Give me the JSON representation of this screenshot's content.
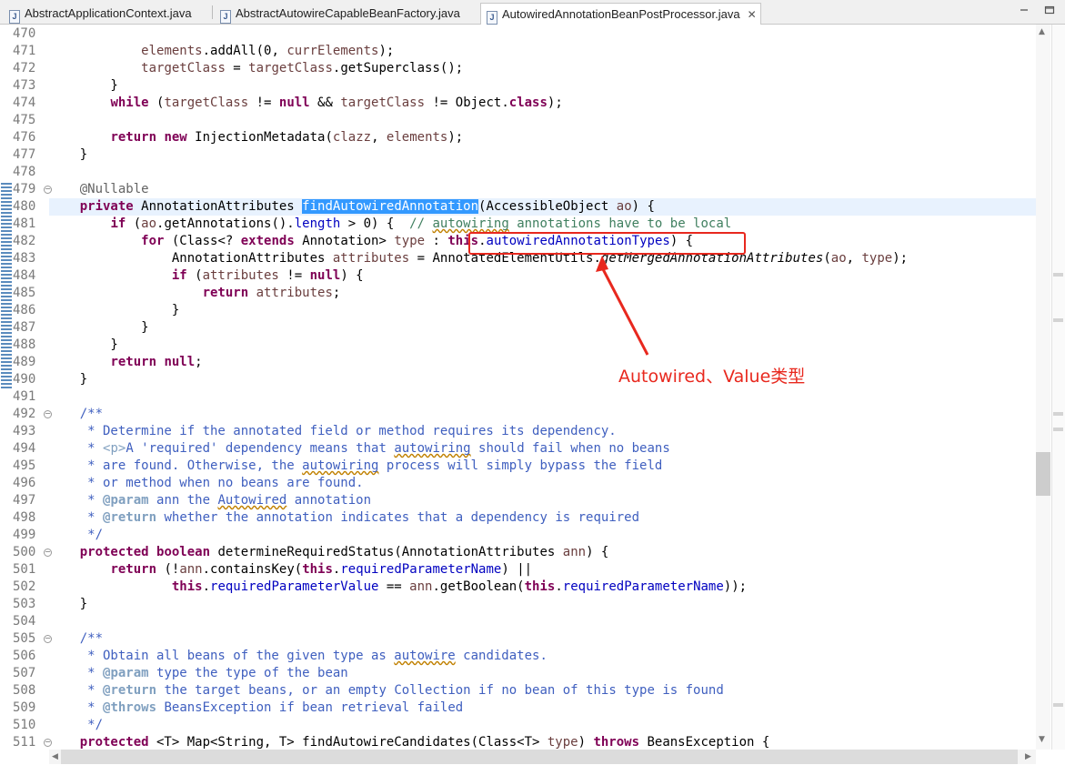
{
  "tabs": [
    {
      "label": "AbstractApplicationContext.java",
      "active": false
    },
    {
      "label": "AbstractAutowireCapableBeanFactory.java",
      "active": false
    },
    {
      "label": "AutowiredAnnotationBeanPostProcessor.java",
      "active": true
    }
  ],
  "tab_close_glyph": "✕",
  "file_icon_glyph": "J",
  "fold_glyph": "⊖",
  "code": {
    "first_line": 470,
    "current_line": 480,
    "fold_lines": [
      479,
      492,
      500,
      505,
      511
    ],
    "lines": [
      "",
      "            elements.addAll(0, currElements);",
      "            targetClass = targetClass.getSuperclass();",
      "        }",
      "        while (targetClass != null && targetClass != Object.class);",
      "",
      "        return new InjectionMetadata(clazz, elements);",
      "    }",
      "",
      "    @Nullable",
      "    private AnnotationAttributes findAutowiredAnnotation(AccessibleObject ao) {",
      "        if (ao.getAnnotations().length > 0) {  // autowiring annotations have to be local",
      "            for (Class<? extends Annotation> type : this.autowiredAnnotationTypes) {",
      "                AnnotationAttributes attributes = AnnotatedElementUtils.getMergedAnnotationAttributes(ao, type);",
      "                if (attributes != null) {",
      "                    return attributes;",
      "                }",
      "            }",
      "        }",
      "        return null;",
      "    }",
      "",
      "    /**",
      "     * Determine if the annotated field or method requires its dependency.",
      "     * <p>A 'required' dependency means that autowiring should fail when no beans",
      "     * are found. Otherwise, the autowiring process will simply bypass the field",
      "     * or method when no beans are found.",
      "     * @param ann the Autowired annotation",
      "     * @return whether the annotation indicates that a dependency is required",
      "     */",
      "    protected boolean determineRequiredStatus(AnnotationAttributes ann) {",
      "        return (!ann.containsKey(this.requiredParameterName) ||",
      "                this.requiredParameterValue == ann.getBoolean(this.requiredParameterName));",
      "    }",
      "",
      "    /**",
      "     * Obtain all beans of the given type as autowire candidates.",
      "     * @param type the type of the bean",
      "     * @return the target beans, or an empty Collection if no bean of this type is found",
      "     * @throws BeansException if bean retrieval failed",
      "     */",
      "    protected <T> Map<String, T> findAutowireCandidates(Class<T> type) throws BeansException {"
    ]
  },
  "annotation": {
    "label": "Autowired、Value类型",
    "color": "#e8281e"
  }
}
